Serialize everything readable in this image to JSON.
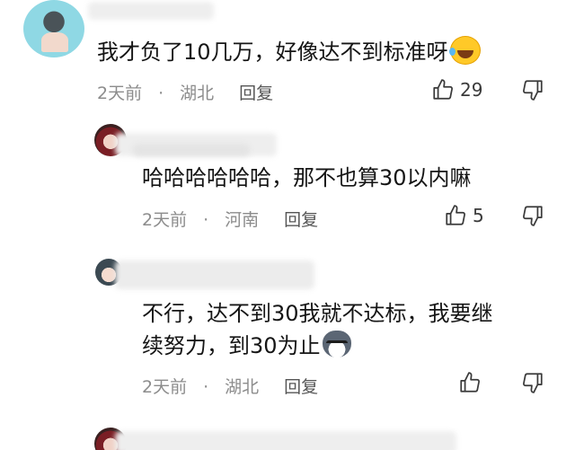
{
  "comments": [
    {
      "text": "我才负了10几万，好像达不到标准呀",
      "emoji": "rofl-emoji",
      "time": "2天前",
      "separator": "·",
      "location": "湖北",
      "reply_label": "回复",
      "likes": "29"
    },
    {
      "text": "哈哈哈哈哈哈，那不也算30以内嘛",
      "time": "2天前",
      "separator": "·",
      "location": "河南",
      "reply_label": "回复",
      "likes": "5"
    },
    {
      "text_line1": "不行，达不到30我就不达标，我要继",
      "text_line2": "续努力，到30为止",
      "emoji": "husky-emoji",
      "time": "2天前",
      "separator": "·",
      "location": "湖北",
      "reply_label": "回复",
      "likes": ""
    }
  ],
  "icons": {
    "like": "thumbs-up-icon",
    "dislike": "thumbs-down-icon"
  },
  "colors": {
    "text": "#151515",
    "meta": "#8c8c8c",
    "background": "#ffffff"
  }
}
